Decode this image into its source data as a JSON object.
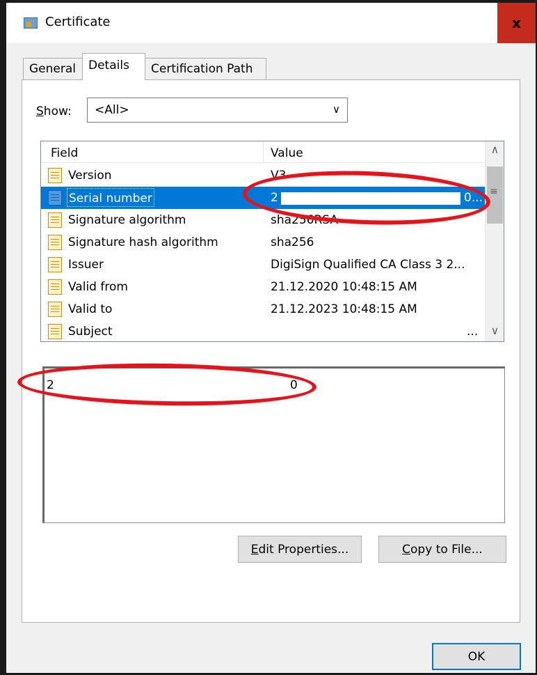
{
  "window": {
    "title": "Certificate",
    "close_label": "x"
  },
  "tabs": [
    {
      "label": "General",
      "active": false
    },
    {
      "label": "Details",
      "active": true
    },
    {
      "label": "Certification Path",
      "active": false
    }
  ],
  "show": {
    "label_accel": "S",
    "label_rest": "how:",
    "selected": "<All>"
  },
  "list": {
    "columns": [
      "Field",
      "Value"
    ],
    "rows": [
      {
        "field": "Version",
        "value": "V3",
        "selected": false
      },
      {
        "field": "Serial number",
        "value": "2",
        "value_tail": "0...",
        "selected": true
      },
      {
        "field": "Signature algorithm",
        "value": "sha256RSA",
        "selected": false
      },
      {
        "field": "Signature hash algorithm",
        "value": "sha256",
        "selected": false
      },
      {
        "field": "Issuer",
        "value": "DigiSign Qualified CA Class 3 2...",
        "selected": false
      },
      {
        "field": "Valid from",
        "value": "21.12.2020 10:48:15 AM",
        "selected": false
      },
      {
        "field": "Valid to",
        "value": "21.12.2023 10:48:15 AM",
        "selected": false
      },
      {
        "field": "Subject",
        "value": "...",
        "selected": false
      }
    ]
  },
  "detail": {
    "start": "2",
    "end": "0"
  },
  "buttons": {
    "edit_accel": "E",
    "edit_rest": "dit Properties...",
    "copy_accel": "C",
    "copy_rest": "opy to File...",
    "ok": "OK"
  },
  "colors": {
    "selection": "#0078d7",
    "annotation": "#e3141b",
    "close_hover": "#c42b1c"
  }
}
